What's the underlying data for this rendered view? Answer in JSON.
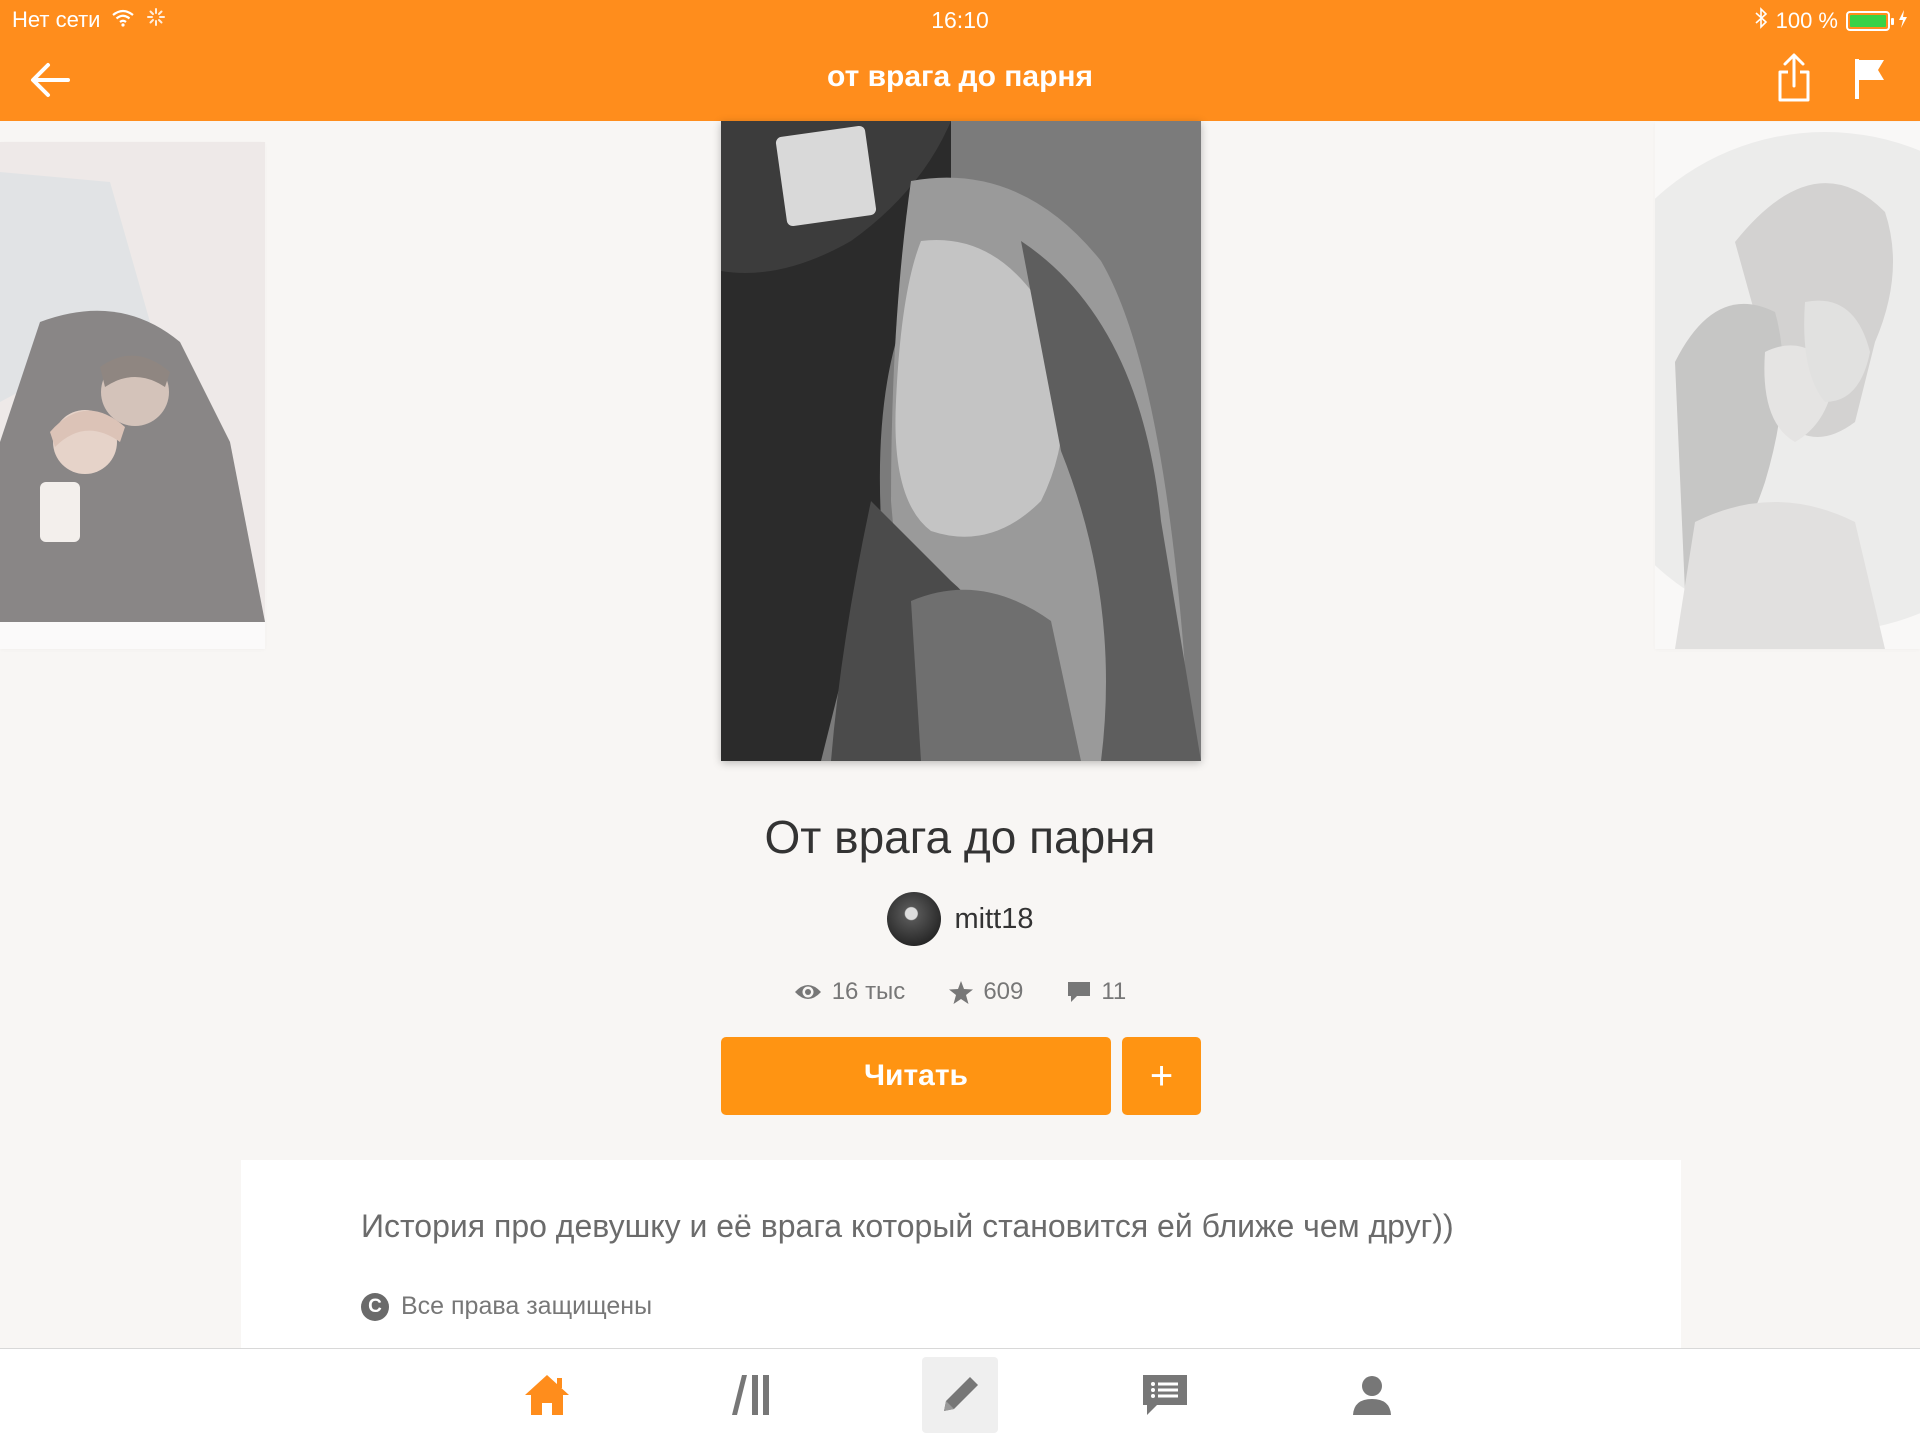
{
  "status_bar": {
    "carrier": "Нет сети",
    "time": "16:10",
    "battery": "100 %",
    "battery_level_percent": 100,
    "battery_color": "#38d247"
  },
  "nav": {
    "title": "от врага до парня",
    "back_icon": "arrow-left-icon",
    "share_icon": "share-icon",
    "report_icon": "flag-icon"
  },
  "story": {
    "title": "От врага до парня",
    "author": "mitt18",
    "views": "16 тыс",
    "votes": "609",
    "comments": "11",
    "read_label": "Читать",
    "add_label": "+",
    "description": "История про девушку и её врага который становится ей ближе чем друг))",
    "rights": "Все права защищены"
  },
  "tabs": [
    {
      "id": "home",
      "icon": "home-icon",
      "active": true
    },
    {
      "id": "library",
      "icon": "library-icon",
      "active": false
    },
    {
      "id": "write",
      "icon": "pencil-icon",
      "active": false
    },
    {
      "id": "messages",
      "icon": "message-icon",
      "active": false
    },
    {
      "id": "profile",
      "icon": "user-icon",
      "active": false
    }
  ],
  "colors": {
    "accent": "#ff8d1c",
    "button": "#ff9412",
    "background": "#f8f6f4"
  }
}
